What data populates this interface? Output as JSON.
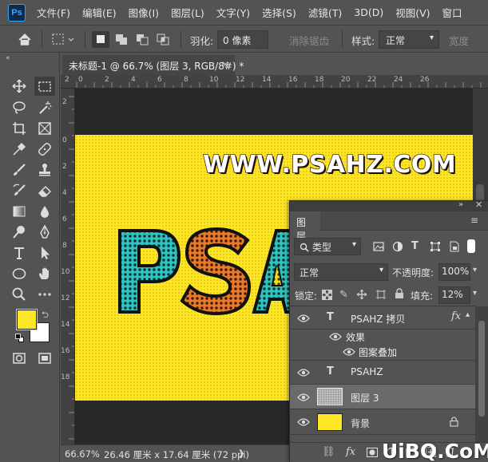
{
  "app": {
    "logo": "Ps"
  },
  "menu": [
    "文件(F)",
    "编辑(E)",
    "图像(I)",
    "图层(L)",
    "文字(Y)",
    "选择(S)",
    "滤镜(T)",
    "3D(D)",
    "视图(V)",
    "窗口"
  ],
  "options": {
    "feather_label": "羽化:",
    "feather_value": "0 像素",
    "antialias_label": "消除锯齿",
    "style_label": "样式:",
    "style_value": "正常",
    "width_label": "宽度"
  },
  "document": {
    "tab_title": "未标题-1 @ 66.7% (图层 3, RGB/8#) *",
    "canvas_url_text": "WWW.PSAHZ.COM",
    "canvas_big_text": "PSA"
  },
  "rulers": {
    "h": [
      "2",
      "0",
      "2",
      "4",
      "6",
      "8",
      "10",
      "12",
      "14",
      "16",
      "18",
      "20",
      "22",
      "24",
      "26"
    ],
    "v": [
      "2",
      "0",
      "2",
      "4",
      "6",
      "8",
      "10",
      "12",
      "14",
      "16",
      "18"
    ]
  },
  "status": {
    "zoom": "66.67%",
    "info": "26.46 厘米 x 17.64 厘米 (72 ppi)",
    "arrow": "❯"
  },
  "colors": {
    "foreground": "#fde626",
    "background": "#ffffff",
    "canvas_yellow": "#fde626"
  },
  "layers_panel": {
    "title": "图层",
    "filter_kind": "类型",
    "blend_mode": "正常",
    "opacity_label": "不透明度:",
    "opacity_value": "100%",
    "lock_label": "锁定:",
    "fill_label": "填充:",
    "fill_value": "12%",
    "fx_label": "fx",
    "layers": [
      {
        "name": "PSAHZ 拷贝",
        "type": "text",
        "has_fx": true
      },
      {
        "name": "效果",
        "type": "effect-group"
      },
      {
        "name": "图案叠加",
        "type": "effect"
      },
      {
        "name": "PSAHZ",
        "type": "text"
      },
      {
        "name": "图层 3",
        "type": "pixel",
        "selected": true
      },
      {
        "name": "背景",
        "type": "background",
        "locked": true
      }
    ]
  },
  "watermark": "UiBQ.CoM"
}
